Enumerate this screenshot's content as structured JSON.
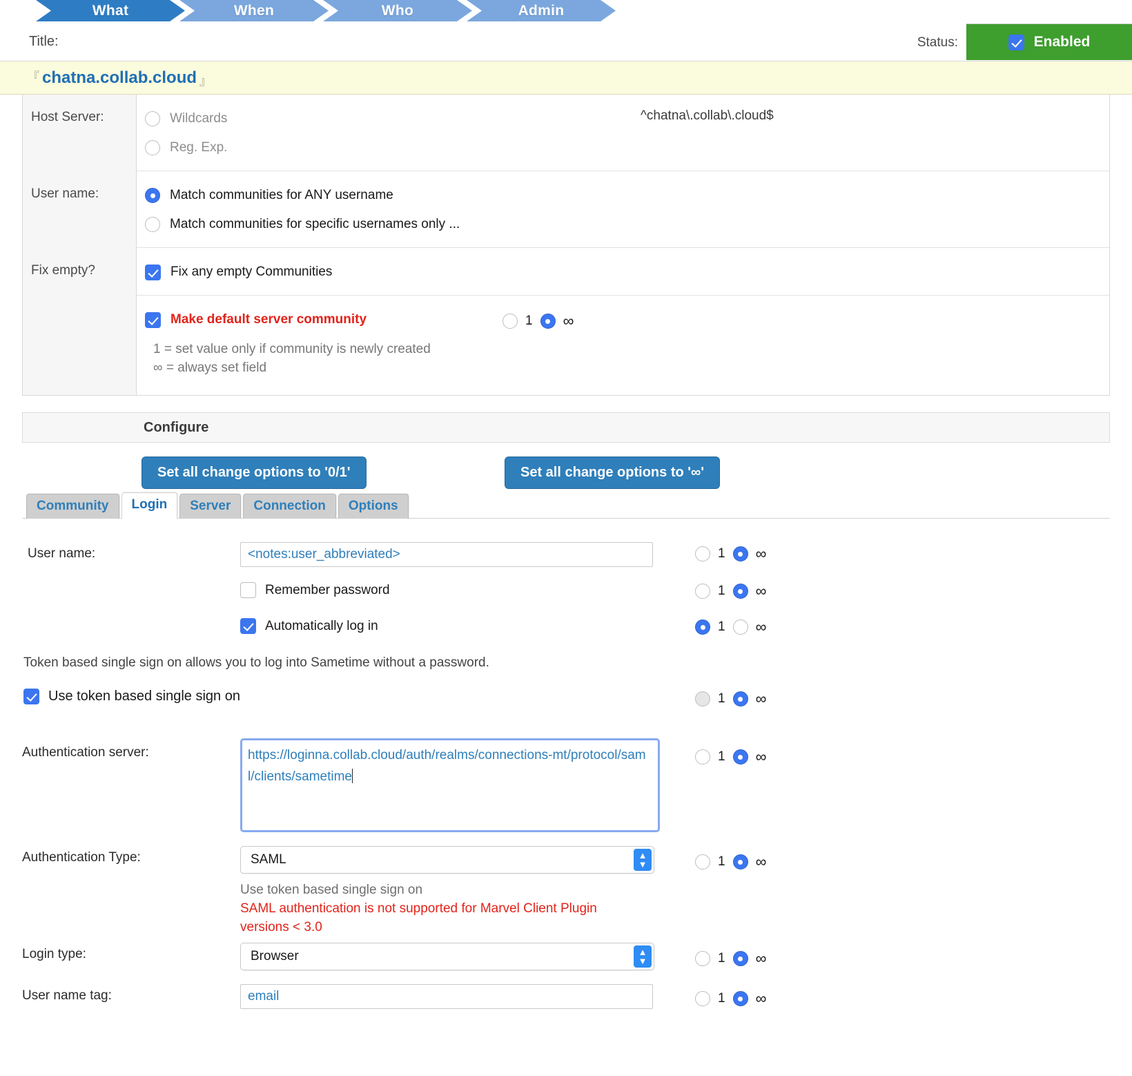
{
  "wizard_nav": {
    "tabs": [
      {
        "label": "What",
        "active": true
      },
      {
        "label": "When",
        "active": false
      },
      {
        "label": "Who",
        "active": false
      },
      {
        "label": "Admin",
        "active": false
      }
    ]
  },
  "header": {
    "title_label": "Title:",
    "status_label": "Status:",
    "status_value": "Enabled",
    "status_checked": true,
    "status_color": "#3e9e2e",
    "title_value": "chatna.collab.cloud",
    "title_bracket_open": "『",
    "title_bracket_close": "』"
  },
  "properties": {
    "host_server": {
      "label": "Host Server:",
      "options": [
        {
          "label": "Wildcards",
          "selected": false,
          "disabled": true
        },
        {
          "label": "Reg. Exp.",
          "selected": false,
          "disabled": true
        }
      ],
      "preview": "^chatna\\.collab\\.cloud$"
    },
    "user_name": {
      "label": "User name:",
      "options": [
        {
          "label": "Match communities for ANY username",
          "selected": true
        },
        {
          "label": "Match communities for specific usernames only ...",
          "selected": false
        }
      ]
    },
    "fix_empty": {
      "label": "Fix empty?",
      "checkbox": {
        "label": "Fix any empty Communities",
        "checked": true
      }
    },
    "default_community": {
      "checkbox": {
        "label": "Make default server community",
        "checked": true,
        "color": "#e2231a"
      },
      "change": {
        "one_label": "1",
        "inf_label": "∞",
        "selected": "inf"
      }
    },
    "hint_lines": [
      "1 = set value only if community is newly created",
      "∞ = always set field"
    ]
  },
  "configure": {
    "heading": "Configure",
    "buttons": [
      {
        "label": "Set all change options to '0/1'"
      },
      {
        "label": "Set all change options to '∞'"
      }
    ],
    "tabs": [
      {
        "label": "Community",
        "active": false
      },
      {
        "label": "Login",
        "active": true
      },
      {
        "label": "Server",
        "active": false
      },
      {
        "label": "Connection",
        "active": false
      },
      {
        "label": "Options",
        "active": false
      }
    ]
  },
  "login_tab": {
    "user_name": {
      "label": "User name:",
      "value": "<notes:user_abbreviated>",
      "change": {
        "one_label": "1",
        "inf_label": "∞",
        "selected": "inf"
      }
    },
    "remember_password": {
      "label": "Remember password",
      "checked": false,
      "change": {
        "one_label": "1",
        "inf_label": "∞",
        "selected": "inf"
      }
    },
    "auto_login": {
      "label": "Automatically log in",
      "checked": true,
      "change": {
        "one_label": "1",
        "inf_label": "∞",
        "selected": "one"
      }
    },
    "sso_description": "Token based single sign on allows you to log into Sametime without a password.",
    "use_token_sso": {
      "label": "Use token based single sign on",
      "checked": true,
      "change": {
        "one_label": "1",
        "inf_label": "∞",
        "selected": "inf"
      }
    },
    "auth_server": {
      "label": "Authentication server:",
      "value": "https://loginna.collab.cloud/auth/realms/connections-mt/protocol/saml/clients/sametime",
      "focused": true,
      "change": {
        "one_label": "1",
        "inf_label": "∞",
        "selected": "inf"
      }
    },
    "auth_type": {
      "label": "Authentication Type:",
      "value": "SAML",
      "change": {
        "one_label": "1",
        "inf_label": "∞",
        "selected": "inf"
      },
      "note": "Use token based single sign on",
      "warning_line1": "SAML authentication is not supported for Marvel Client Plugin",
      "warning_line2": "versions < 3.0"
    },
    "login_type": {
      "label": "Login type:",
      "value": "Browser",
      "change": {
        "one_label": "1",
        "inf_label": "∞",
        "selected": "inf"
      }
    },
    "user_name_tag": {
      "label": "User name tag:",
      "value": "email",
      "change": {
        "one_label": "1",
        "inf_label": "∞",
        "selected": "inf"
      }
    }
  }
}
